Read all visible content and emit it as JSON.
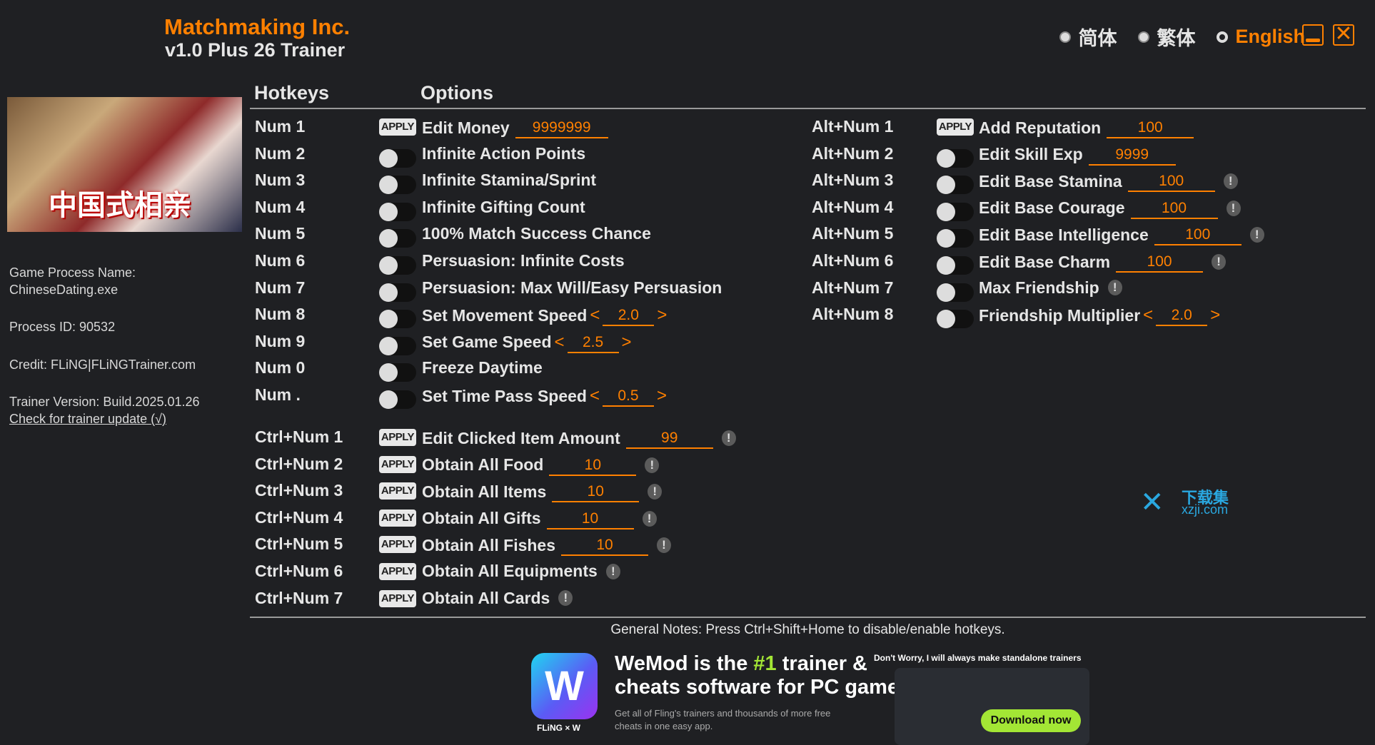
{
  "header": {
    "title": "Matchmaking Inc.",
    "subtitle": "v1.0 Plus 26 Trainer"
  },
  "languages": [
    {
      "label": "简体",
      "selected": false
    },
    {
      "label": "繁体",
      "selected": false
    },
    {
      "label": "English",
      "selected": true
    }
  ],
  "window": {
    "minimize_icon": "minimize-icon",
    "close_icon": "close-icon",
    "accent": "#ff8000"
  },
  "cover": {
    "logo_text": "中国式相亲"
  },
  "sidebar": {
    "process_name_label": "Game Process Name:",
    "process_name": "ChineseDating.exe",
    "process_id": "Process ID: 90532",
    "credit": "Credit: FLiNG|FLiNGTrainer.com",
    "version": "Trainer Version: Build.2025.01.26",
    "update_link": "Check for trainer update (√)"
  },
  "columns": {
    "hotkeys": "Hotkeys",
    "options": "Options"
  },
  "apply_label": "APPLY",
  "left_options": [
    {
      "hotkey": "Num 1",
      "control": "apply",
      "label": "Edit Money",
      "input": "9999999"
    },
    {
      "hotkey": "Num 2",
      "control": "toggle",
      "label": "Infinite Action Points"
    },
    {
      "hotkey": "Num 3",
      "control": "toggle",
      "label": "Infinite Stamina/Sprint"
    },
    {
      "hotkey": "Num 4",
      "control": "toggle",
      "label": "Infinite Gifting Count"
    },
    {
      "hotkey": "Num 5",
      "control": "toggle",
      "label": "100% Match Success Chance"
    },
    {
      "hotkey": "Num 6",
      "control": "toggle",
      "label": "Persuasion: Infinite Costs"
    },
    {
      "hotkey": "Num 7",
      "control": "toggle",
      "label": "Persuasion: Max Will/Easy Persuasion"
    },
    {
      "hotkey": "Num 8",
      "control": "toggle",
      "label": "Set Movement Speed",
      "stepper": "2.0"
    },
    {
      "hotkey": "Num 9",
      "control": "toggle",
      "label": "Set Game Speed",
      "stepper": "2.5"
    },
    {
      "hotkey": "Num 0",
      "control": "toggle",
      "label": "Freeze Daytime"
    },
    {
      "hotkey": "Num .",
      "control": "toggle",
      "label": "Set Time Pass Speed",
      "stepper": "0.5"
    }
  ],
  "ctrl_options": [
    {
      "hotkey": "Ctrl+Num 1",
      "control": "apply",
      "label": "Edit Clicked Item Amount",
      "input": "99",
      "warn": true
    },
    {
      "hotkey": "Ctrl+Num 2",
      "control": "apply",
      "label": "Obtain All Food",
      "input": "10",
      "warn": true
    },
    {
      "hotkey": "Ctrl+Num 3",
      "control": "apply",
      "label": "Obtain All Items",
      "input": "10",
      "warn": true
    },
    {
      "hotkey": "Ctrl+Num 4",
      "control": "apply",
      "label": "Obtain All Gifts",
      "input": "10",
      "warn": true
    },
    {
      "hotkey": "Ctrl+Num 5",
      "control": "apply",
      "label": "Obtain All Fishes",
      "input": "10",
      "warn": true
    },
    {
      "hotkey": "Ctrl+Num 6",
      "control": "apply",
      "label": "Obtain All Equipments",
      "warn": true
    },
    {
      "hotkey": "Ctrl+Num 7",
      "control": "apply",
      "label": "Obtain All Cards",
      "warn": true
    }
  ],
  "right_options": [
    {
      "hotkey": "Alt+Num 1",
      "control": "apply",
      "label": "Add Reputation",
      "input": "100"
    },
    {
      "hotkey": "Alt+Num 2",
      "control": "toggle",
      "label": "Edit Skill Exp",
      "input": "9999"
    },
    {
      "hotkey": "Alt+Num 3",
      "control": "toggle",
      "label": "Edit Base Stamina",
      "input": "100",
      "warn": true
    },
    {
      "hotkey": "Alt+Num 4",
      "control": "toggle",
      "label": "Edit Base Courage",
      "input": "100",
      "warn": true
    },
    {
      "hotkey": "Alt+Num 5",
      "control": "toggle",
      "label": "Edit Base Intelligence",
      "input": "100",
      "warn": true
    },
    {
      "hotkey": "Alt+Num 6",
      "control": "toggle",
      "label": "Edit Base Charm",
      "input": "100",
      "warn": true
    },
    {
      "hotkey": "Alt+Num 7",
      "control": "toggle",
      "label": "Max Friendship",
      "warn": true
    },
    {
      "hotkey": "Alt+Num 8",
      "control": "toggle",
      "label": "Friendship Multiplier",
      "stepper": "2.0"
    }
  ],
  "notes": "General Notes: Press Ctrl+Shift+Home to disable/enable hotkeys.",
  "ad": {
    "headline_a": "WeMod is the ",
    "headline_highlight": "#1",
    "headline_b": " trainer &",
    "headline_line2": "cheats software for PC games",
    "body": "Get all of Fling's trainers and thousands of more free cheats in one easy app.",
    "brand": "FLiNG × W",
    "note": "Don't Worry, I will always make standalone trainers",
    "download": "Download now"
  },
  "watermark": {
    "line1": "下载集",
    "line2": "xzji.com"
  }
}
